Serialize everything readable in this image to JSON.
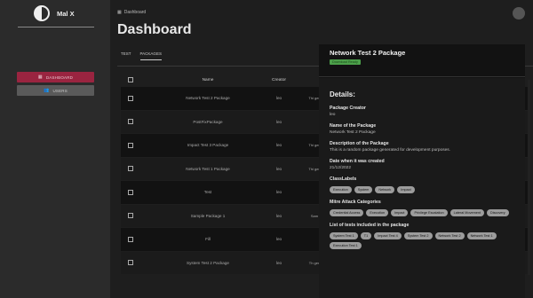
{
  "sidebar": {
    "user_name": "Mal X",
    "items": [
      {
        "label": "DASHBOARD",
        "icon": "dashboard-icon"
      },
      {
        "label": "USERS",
        "icon": "users-icon"
      }
    ]
  },
  "header": {
    "breadcrumb": "Dashboard",
    "title": "Dashboard"
  },
  "tabs": [
    {
      "label": "TEST"
    },
    {
      "label": "PACKAGES"
    }
  ],
  "table": {
    "headers": [
      "Name",
      "Creator"
    ],
    "rows": [
      {
        "name": "Network Test 2 Package",
        "creator": "leo",
        "desc": "Thi gen"
      },
      {
        "name": "PostFixPackage",
        "creator": "leo",
        "desc": ""
      },
      {
        "name": "Impact Test 3 Package",
        "creator": "leo",
        "desc": "Thi gen"
      },
      {
        "name": "Network Test 1 Package",
        "creator": "leo",
        "desc": "Thi gen"
      },
      {
        "name": "Test",
        "creator": "leo",
        "desc": ""
      },
      {
        "name": "Sample Package 1",
        "creator": "leo",
        "desc": "Sam"
      },
      {
        "name": "Fill",
        "creator": "leo",
        "desc": ""
      },
      {
        "name": "System Test 2 Package",
        "creator": "leo",
        "desc": "Th gen"
      }
    ]
  },
  "details": {
    "title": "Network Test 2 Package",
    "download_label": "Download Ready",
    "heading": "Details:",
    "creator_label": "Package Creator",
    "creator_value": "leo",
    "name_label": "Name of the Package",
    "name_value": "Network Test 2 Package",
    "desc_label": "Description of the Package",
    "desc_value": "This is a random package generated for development purposes.",
    "date_label": "Date when it was created",
    "date_value": "21/12/2022",
    "class_label": "ClassLabels",
    "class_chips": [
      "Execution",
      "System",
      "Network",
      "Impact"
    ],
    "mitre_label": "Mitre Attack Categories",
    "mitre_chips": [
      "Credential Access",
      "Execution",
      "Impact",
      "Privilege Escalation",
      "Lateral Movement",
      "Discovery"
    ],
    "tests_label": "List of tests included in the package",
    "tests_chips": [
      "System Test 1",
      "T1",
      "Impact Test 4",
      "System Test 2",
      "Network Test 2",
      "Network Test 1",
      "Execution Test 1"
    ]
  }
}
